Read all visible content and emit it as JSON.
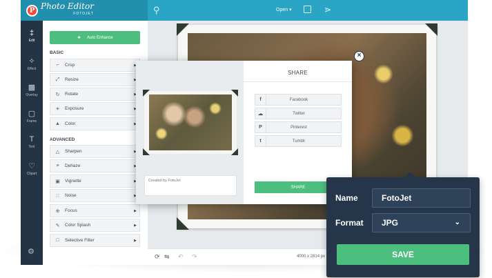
{
  "app": {
    "logo_letter": "P",
    "logo_title": "Photo Editor",
    "logo_sub": "FOTOJET"
  },
  "topbar": {
    "open_label": "Open ▾",
    "icons": [
      "bulb-icon",
      "save-icon",
      "share-icon"
    ]
  },
  "rail": {
    "items": [
      {
        "icon": "‡",
        "label": "Edit"
      },
      {
        "icon": "✧",
        "label": "Effect"
      },
      {
        "icon": "▩",
        "label": "Overlay"
      },
      {
        "icon": "▢",
        "label": "Frame"
      },
      {
        "icon": "T",
        "label": "Text"
      },
      {
        "icon": "♡",
        "label": "Clipart"
      }
    ],
    "settings_icon": "⚙"
  },
  "panel": {
    "enhance_label": "Auto Enhance",
    "basic_title": "BASIC",
    "basic_tools": [
      {
        "icon": "⌐",
        "label": "Crop"
      },
      {
        "icon": "⤢",
        "label": "Resize"
      },
      {
        "icon": "↻",
        "label": "Rotate"
      },
      {
        "icon": "☀",
        "label": "Exposure"
      },
      {
        "icon": "▲",
        "label": "Color"
      }
    ],
    "advanced_title": "ADVANCED",
    "advanced_tools": [
      {
        "icon": "△",
        "label": "Sharpen"
      },
      {
        "icon": "≡",
        "label": "Dehaze"
      },
      {
        "icon": "▣",
        "label": "Vignette"
      },
      {
        "icon": "∷",
        "label": "Noise"
      },
      {
        "icon": "⊕",
        "label": "Focus"
      },
      {
        "icon": "✎",
        "label": "Color Splash"
      },
      {
        "icon": "□",
        "label": "Selective Filter"
      }
    ]
  },
  "bottombar": {
    "dimensions": "4000 x 2814 px"
  },
  "share_dialog": {
    "title": "SHARE",
    "credit": "Created by FotoJet",
    "buttons": [
      {
        "icon": "f",
        "label": "Facebook"
      },
      {
        "icon": "☁",
        "label": "Twitter"
      },
      {
        "icon": "P",
        "label": "Pinterest"
      },
      {
        "icon": "t",
        "label": "Tumblr"
      }
    ],
    "share_label": "SHARE",
    "close_glyph": "×"
  },
  "save_popup": {
    "name_label": "Name",
    "name_value": "FotoJet",
    "format_label": "Format",
    "format_value": "JPG",
    "save_label": "SAVE"
  },
  "colors": {
    "topbar": "#2aa5c6",
    "rail": "#243444",
    "accent_green": "#4cbf7e",
    "popup_bg": "#25364a"
  }
}
